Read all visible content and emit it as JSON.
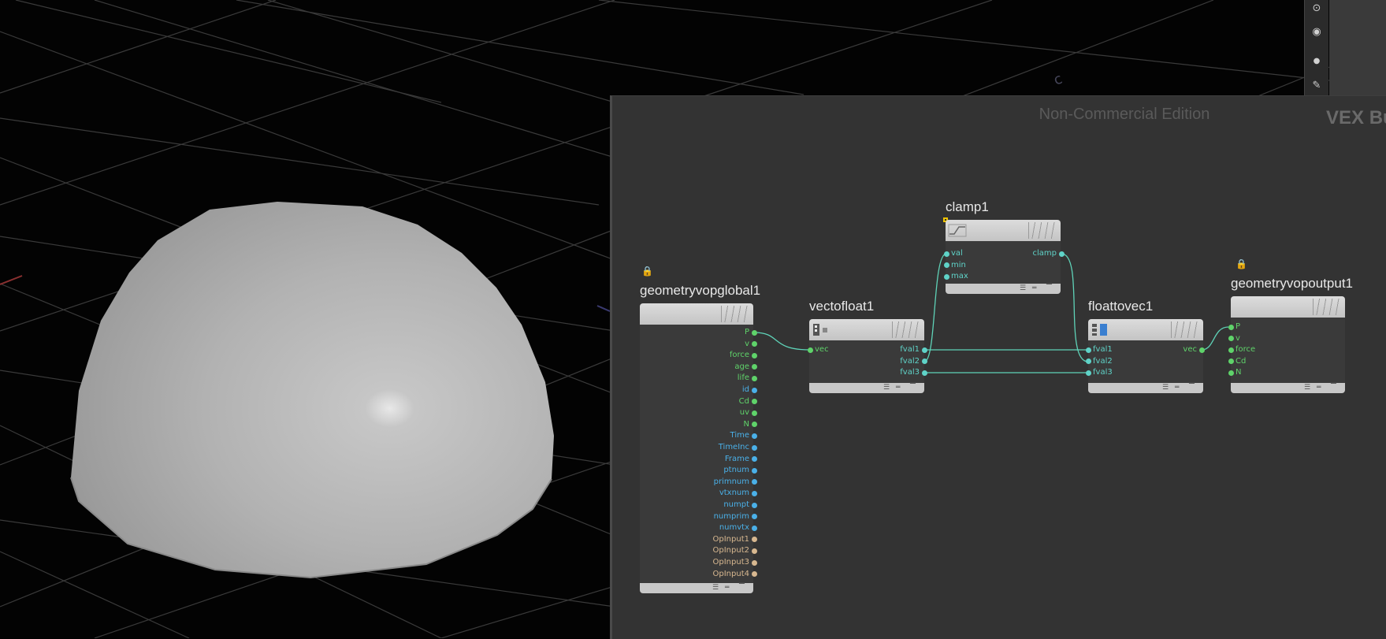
{
  "net_editor": {
    "watermark": "Non-Commercial Edition",
    "context_label": "VEX Bu"
  },
  "viewport": {
    "axis_label": "c",
    "object": "hemisphere"
  },
  "colors": {
    "port_green": "#5fd36a",
    "port_blue": "#4ab0e8",
    "port_tan": "#d8b890",
    "port_cyan": "#5fd3c8",
    "wire": "#5fd3b8",
    "selected_outline": "#f0c400"
  },
  "nodes": {
    "global": {
      "name": "geometryvopglobal1",
      "ports": [
        "P",
        "v",
        "force",
        "age",
        "life",
        "id",
        "Cd",
        "uv",
        "N",
        "Time",
        "TimeInc",
        "Frame",
        "ptnum",
        "primnum",
        "vtxnum",
        "numpt",
        "numprim",
        "numvtx",
        "OpInput1",
        "OpInput2",
        "OpInput3",
        "OpInput4"
      ]
    },
    "vectofloat": {
      "name": "vectofloat1",
      "inputs": [
        "vec"
      ],
      "outputs": [
        "fval1",
        "fval2",
        "fval3"
      ]
    },
    "clamp": {
      "name": "clamp1",
      "inputs": [
        "val",
        "min",
        "max"
      ],
      "outputs": [
        "clamp"
      ]
    },
    "floattovec": {
      "name": "floattovec1",
      "inputs": [
        "fval1",
        "fval2",
        "fval3"
      ],
      "outputs": [
        "vec"
      ]
    },
    "output": {
      "name": "geometryvopoutput1",
      "inputs": [
        "P",
        "v",
        "force",
        "Cd",
        "N"
      ]
    }
  },
  "icons": [
    "eye-scale-icon",
    "eye-display-icon",
    "point-icon",
    "brush-icon",
    "lock-icon"
  ]
}
